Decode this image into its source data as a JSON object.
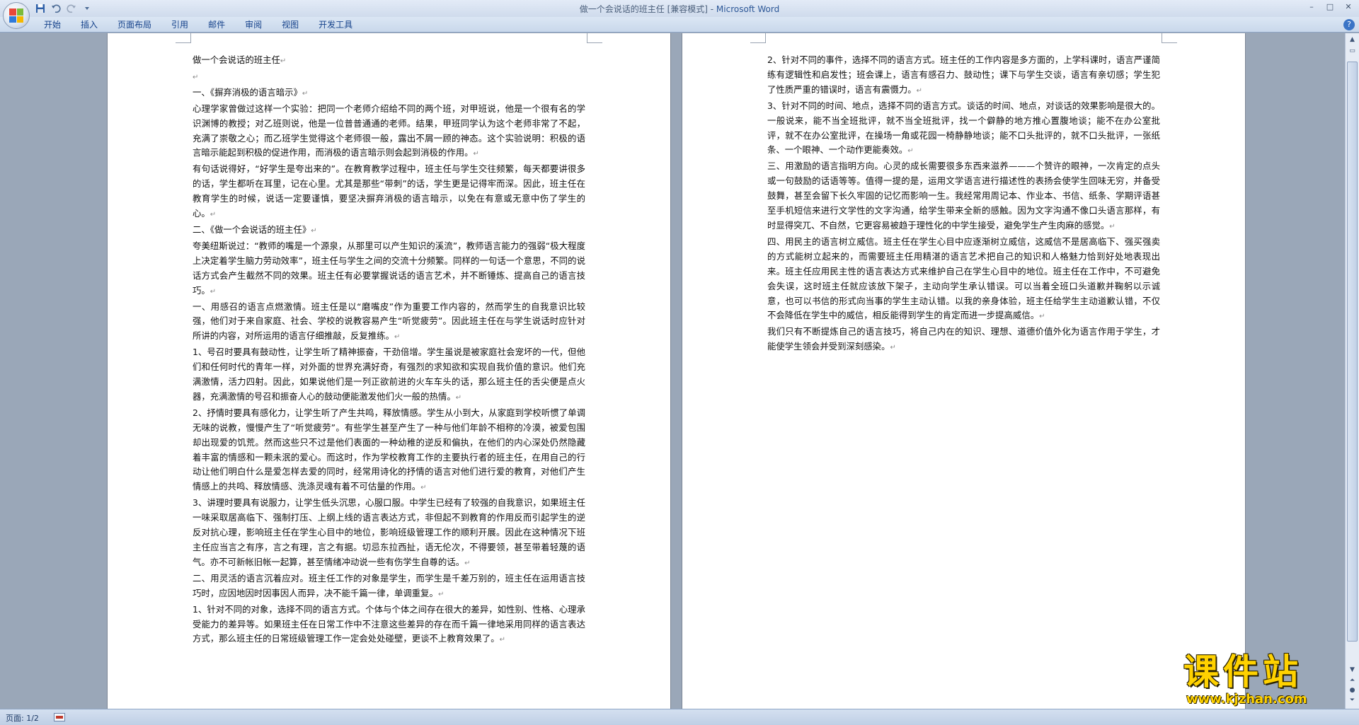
{
  "window": {
    "title": "做一个会说话的班主任 [兼容模式] - ",
    "app_name": "Microsoft Word",
    "controls": [
      "–",
      "□",
      "✕"
    ]
  },
  "quick_access": {
    "save_icon": "save-icon",
    "undo_icon": "undo-icon",
    "redo_icon": "redo-icon",
    "customize_icon": "dropdown-icon"
  },
  "ribbon": {
    "tabs": [
      "开始",
      "插入",
      "页面布局",
      "引用",
      "邮件",
      "审阅",
      "视图",
      "开发工具"
    ],
    "help": "?"
  },
  "document": {
    "pages": [
      {
        "paragraphs": [
          "做一个会说话的班主任",
          "",
          "一、《摒弃消极的语言暗示》",
          "心理学家曾做过这样一个实验：把同一个老师介绍给不同的两个班，对甲班说，他是一个很有名的学识渊博的教授；对乙班则说，他是一位普普通通的老师。结果，甲班同学认为这个老师非常了不起，充满了崇敬之心；而乙班学生觉得这个老师很一般，露出不屑一顾的神态。这个实验说明：积极的语言暗示能起到积极的促进作用，而消极的语言暗示则会起到消极的作用。",
          "有句话说得好，“好学生是夸出来的”。在教育教学过程中，班主任与学生交往频繁，每天都要讲很多的话，学生都听在耳里，记在心里。尤其是那些“带刺”的话，学生更是记得牢而深。因此，班主任在教育学生的时候，说话一定要谨慎，要坚决摒弃消极的语言暗示，以免在有意或无意中伤了学生的心。",
          "二、《做一个会说话的班主任》",
          "夸美纽斯说过：“教师的嘴是一个源泉，从那里可以产生知识的溪流”，教师语言能力的强弱“极大程度上决定着学生脑力劳动效率”，班主任与学生之间的交流十分频繁。同样的一句话一个意思，不同的说话方式会产生截然不同的效果。班主任有必要掌握说话的语言艺术，并不断锤炼、提高自己的语言技巧。",
          "一、用感召的语言点燃激情。班主任是以“磨嘴皮”作为重要工作内容的，然而学生的自我意识比较强，他们对于来自家庭、社会、学校的说教容易产生“听觉疲劳”。因此班主任在与学生说话时应针对所讲的内容，对所运用的语言仔细推敲，反复推练。",
          "1、号召时要具有鼓动性，让学生听了精神振奋，干劲倍增。学生虽说是被家庭社会宠坏的一代，但他们和任何时代的青年一样，对外面的世界充满好奇，有强烈的求知欲和实现自我价值的意识。他们充满激情，活力四射。因此，如果说他们是一列正欲前进的火车车头的话，那么班主任的舌尖便是点火器，充满激情的号召和振奋人心的鼓动便能激发他们火一般的热情。",
          "2、抒情时要具有感化力，让学生听了产生共鸣，释放情感。学生从小到大，从家庭到学校听惯了单调无味的说教，慢慢产生了“听觉疲劳”。有些学生甚至产生了一种与他们年龄不相称的冷漠，被爱包围却出现爱的饥荒。然而这些只不过是他们表面的一种幼稚的逆反和偏执，在他们的内心深处仍然隐藏着丰富的情感和一颗未泯的爱心。而这时，作为学校教育工作的主要执行者的班主任，在用自己的行动让他们明白什么是爱怎样去爱的同时，经常用诗化的抒情的语言对他们进行爱的教育，对他们产生情感上的共鸣、释放情感、洗涤灵魂有着不可估量的作用。",
          "3、讲理时要具有说服力，让学生低头沉思，心服口服。中学生已经有了较强的自我意识，如果班主任一味采取居高临下、强制打压、上纲上线的语言表达方式，非但起不到教育的作用反而引起学生的逆反对抗心理，影响班主任在学生心目中的地位，影响班级管理工作的顺利开展。因此在这种情况下班主任应当言之有序，言之有理，言之有据。切忌东拉西扯，语无伦次，不得要领，甚至带着轻蔑的语气。亦不可新帐旧帐一起算，甚至情绪冲动说一些有伤学生自尊的话。",
          "二、用灵活的语言沉着应对。班主任工作的对象是学生，而学生是千差万别的，班主任在运用语言技巧时，应因地因时因事因人而异，决不能千篇一律，单调重复。",
          "1、针对不同的对象，选择不同的语言方式。个体与个体之间存在很大的差异，如性别、性格、心理承受能力的差异等。如果班主任在日常工作中不注意这些差异的存在而千篇一律地采用同样的语言表达方式，那么班主任的日常班级管理工作一定会处处碰壁，更谈不上教育效果了。"
        ]
      },
      {
        "paragraphs": [
          "2、针对不同的事件，选择不同的语言方式。班主任的工作内容是多方面的，上学科课时，语言严谨简练有逻辑性和启发性；班会课上，语言有感召力、鼓动性；课下与学生交谈，语言有亲切感；学生犯了性质严重的错误时，语言有震慑力。",
          "3、针对不同的时间、地点，选择不同的语言方式。谈话的时间、地点，对谈话的效果影响是很大的。一般说来，能不当全班批评，就不当全班批评，找一个僻静的地方推心置腹地谈；能不在办公室批评，就不在办公室批评，在操场一角或花园一椅静静地谈；能不口头批评的，就不口头批评，一张纸条、一个眼神、一个动作更能奏效。",
          "三、用激励的语言指明方向。心灵的成长需要很多东西来滋养———个赞许的眼神，一次肯定的点头或一句鼓励的话语等等。值得一提的是，运用文学语言进行描述性的表扬会使学生回味无穷，并备受鼓舞，甚至会留下长久牢固的记忆而影响一生。我经常用周记本、作业本、书信、纸条、学期评语甚至手机短信来进行文学性的文字沟通，给学生带来全新的感触。因为文字沟通不像口头语言那样，有时显得突兀、不自然，它更容易被趋于理性化的中学生接受，避免学生产生肉麻的感觉。",
          "四、用民主的语言树立威信。班主任在学生心目中应逐渐树立威信，这威信不是居高临下、强买强卖的方式能树立起来的，而需要班主任用精湛的语言艺术把自己的知识和人格魅力恰到好处地表现出来。班主任应用民主性的语言表达方式来维护自己在学生心目中的地位。班主任在工作中，不可避免会失误，这时班主任就应该放下架子，主动向学生承认错误。可以当着全班口头道歉并鞠躬以示诚意，也可以书信的形式向当事的学生主动认错。以我的亲身体验，班主任给学生主动道歉认错，不仅不会降低在学生中的威信，相反能得到学生的肯定而进一步提高威信。",
          "我们只有不断提炼自己的语言技巧，将自己内在的知识、理想、道德价值外化为语言作用于学生，才能使学生领会并受到深刻感染。"
        ]
      }
    ]
  },
  "statusbar": {
    "page_info": "页面: 1/2",
    "proofing_icon": "proofing-icon"
  },
  "watermark": {
    "title": "课件站",
    "url": "www.kjzhan.com"
  },
  "colors": {
    "accent": "#15428b",
    "background": "#9aa7b8",
    "watermark": "#ffd200"
  }
}
